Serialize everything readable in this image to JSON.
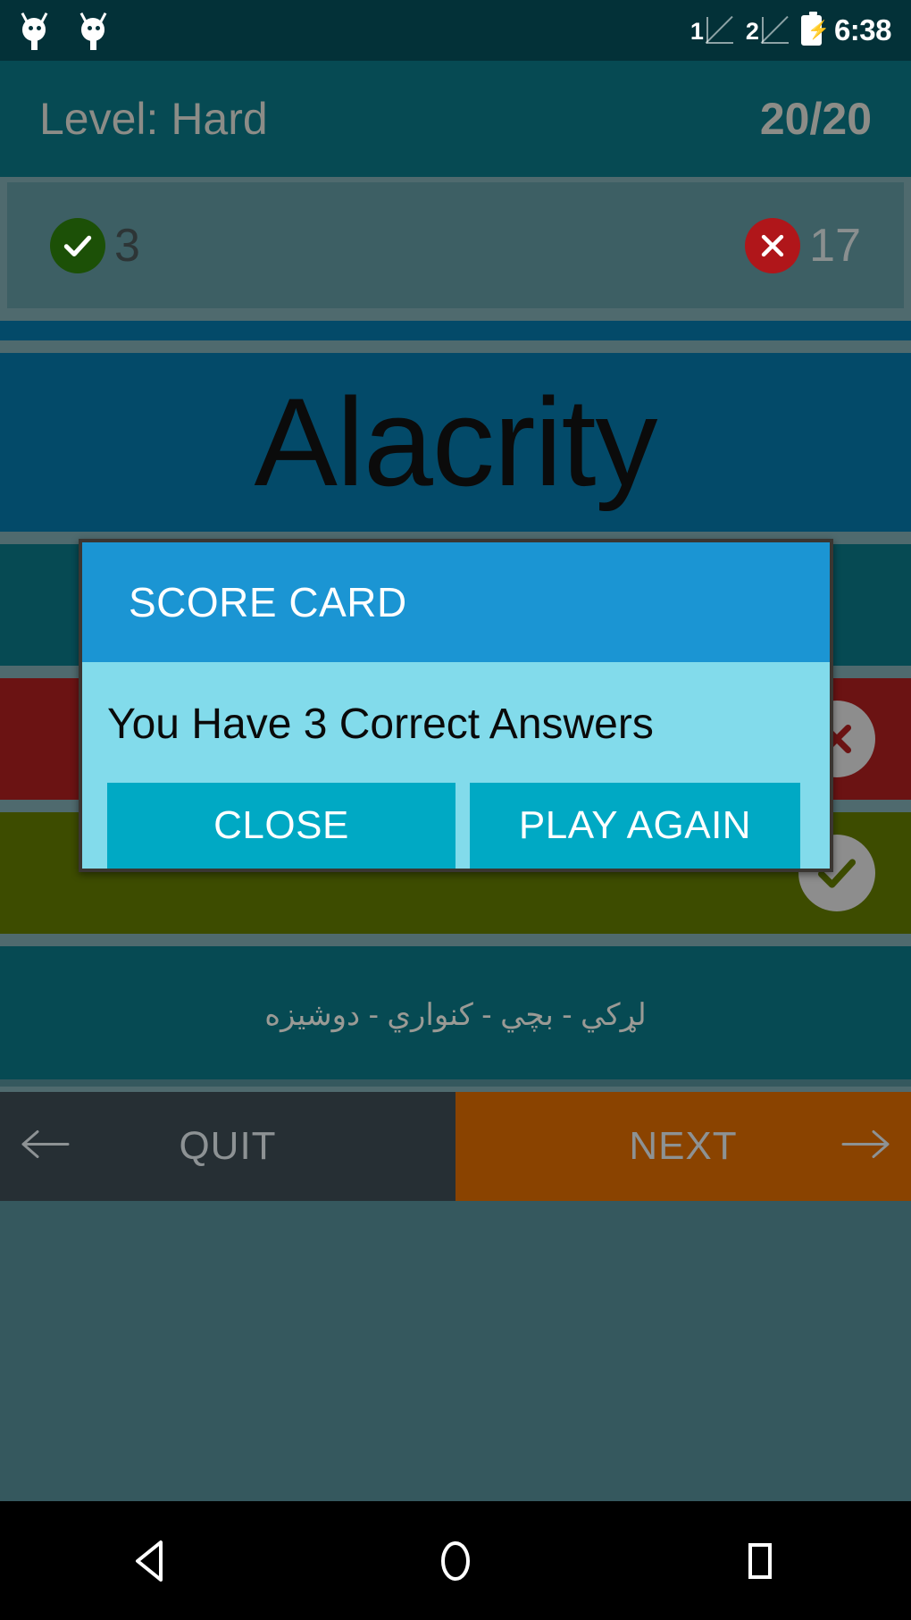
{
  "statusbar": {
    "notification_icons": [
      "bug-icon",
      "bug-icon"
    ],
    "sim1_label": "1",
    "sim2_label": "2",
    "battery_icon": "battery-charging-icon",
    "clock": "6:38"
  },
  "header": {
    "level_label": "Level: Hard",
    "progress_label": "20/20"
  },
  "score": {
    "correct_icon": "check-circle-icon",
    "correct_count": "3",
    "wrong_icon": "x-circle-icon",
    "wrong_count": "17"
  },
  "question": {
    "word": "Alacrity",
    "hint": "لړکي - بچي - كنواري - دوشيزه"
  },
  "answers": [
    {
      "text": "",
      "state": "neutral",
      "icon": ""
    },
    {
      "text": "",
      "state": "neutral",
      "icon": ""
    },
    {
      "text": "",
      "state": "wrong",
      "icon": "x-circle-icon"
    },
    {
      "text": "",
      "state": "correct",
      "icon": "check-circle-icon"
    }
  ],
  "actionbar": {
    "quit_label": "QUIT",
    "quit_icon": "arrow-left-icon",
    "next_label": "NEXT",
    "next_icon": "arrow-right-icon"
  },
  "dialog": {
    "title": "SCORE CARD",
    "message": "You Have 3 Correct Answers",
    "close_label": "CLOSE",
    "play_again_label": "PLAY AGAIN"
  },
  "navbar": {
    "back_icon": "triangle-back-icon",
    "home_icon": "circle-home-icon",
    "recents_icon": "square-recents-icon"
  },
  "colors": {
    "statusbar_bg": "#033138",
    "header_bg": "#064a53",
    "score_bg": "#3d5f64",
    "divider": "#4f6a6e",
    "question_bg": "#034a69",
    "answer_wrong_bg": "#6b1313",
    "answer_correct_bg": "#3d4c00",
    "answer_neutral_bg": "#064a53",
    "dialog_header": "#1b95d3",
    "dialog_body": "#82dbeb",
    "dialog_button": "#00a9c4",
    "next_bg": "#8a4300",
    "quit_bg": "#262f34",
    "page_bg": "#35585e"
  }
}
